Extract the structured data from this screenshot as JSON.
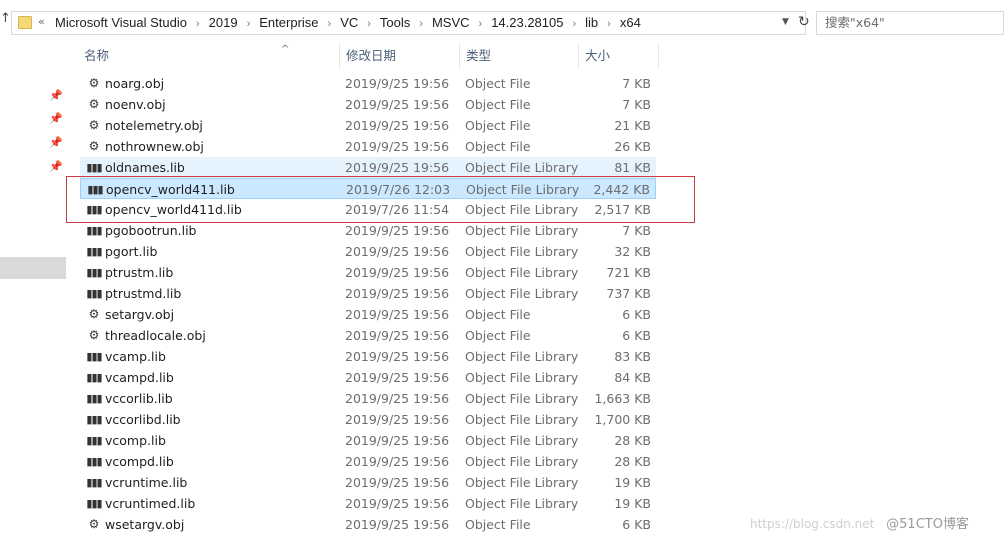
{
  "address_bar": {
    "breadcrumbs": [
      "Microsoft Visual Studio",
      "2019",
      "Enterprise",
      "VC",
      "Tools",
      "MSVC",
      "14.23.28105",
      "lib",
      "x64"
    ]
  },
  "search": {
    "placeholder": "搜索\"x64\""
  },
  "columns": {
    "name": "名称",
    "modified": "修改日期",
    "type": "类型",
    "size": "大小"
  },
  "files": [
    {
      "name": "noarg.obj",
      "modified": "2019/9/25 19:56",
      "type": "Object File",
      "size": "7 KB",
      "icon": "obj-file-icon"
    },
    {
      "name": "noenv.obj",
      "modified": "2019/9/25 19:56",
      "type": "Object File",
      "size": "7 KB",
      "icon": "obj-file-icon"
    },
    {
      "name": "notelemetry.obj",
      "modified": "2019/9/25 19:56",
      "type": "Object File",
      "size": "21 KB",
      "icon": "obj-file-icon"
    },
    {
      "name": "nothrownew.obj",
      "modified": "2019/9/25 19:56",
      "type": "Object File",
      "size": "26 KB",
      "icon": "obj-file-icon"
    },
    {
      "name": "oldnames.lib",
      "modified": "2019/9/25 19:56",
      "type": "Object File Library",
      "size": "81 KB",
      "icon": "lib-file-icon",
      "state": "hover"
    },
    {
      "name": "opencv_world411.lib",
      "modified": "2019/7/26 12:03",
      "type": "Object File Library",
      "size": "2,442 KB",
      "icon": "lib-file-icon",
      "state": "selected"
    },
    {
      "name": "opencv_world411d.lib",
      "modified": "2019/7/26 11:54",
      "type": "Object File Library",
      "size": "2,517 KB",
      "icon": "lib-file-icon"
    },
    {
      "name": "pgobootrun.lib",
      "modified": "2019/9/25 19:56",
      "type": "Object File Library",
      "size": "7 KB",
      "icon": "lib-file-icon"
    },
    {
      "name": "pgort.lib",
      "modified": "2019/9/25 19:56",
      "type": "Object File Library",
      "size": "32 KB",
      "icon": "lib-file-icon"
    },
    {
      "name": "ptrustm.lib",
      "modified": "2019/9/25 19:56",
      "type": "Object File Library",
      "size": "721 KB",
      "icon": "lib-file-icon"
    },
    {
      "name": "ptrustmd.lib",
      "modified": "2019/9/25 19:56",
      "type": "Object File Library",
      "size": "737 KB",
      "icon": "lib-file-icon"
    },
    {
      "name": "setargv.obj",
      "modified": "2019/9/25 19:56",
      "type": "Object File",
      "size": "6 KB",
      "icon": "obj-file-icon"
    },
    {
      "name": "threadlocale.obj",
      "modified": "2019/9/25 19:56",
      "type": "Object File",
      "size": "6 KB",
      "icon": "obj-file-icon"
    },
    {
      "name": "vcamp.lib",
      "modified": "2019/9/25 19:56",
      "type": "Object File Library",
      "size": "83 KB",
      "icon": "lib-file-icon"
    },
    {
      "name": "vcampd.lib",
      "modified": "2019/9/25 19:56",
      "type": "Object File Library",
      "size": "84 KB",
      "icon": "lib-file-icon"
    },
    {
      "name": "vccorlib.lib",
      "modified": "2019/9/25 19:56",
      "type": "Object File Library",
      "size": "1,663 KB",
      "icon": "lib-file-icon"
    },
    {
      "name": "vccorlibd.lib",
      "modified": "2019/9/25 19:56",
      "type": "Object File Library",
      "size": "1,700 KB",
      "icon": "lib-file-icon"
    },
    {
      "name": "vcomp.lib",
      "modified": "2019/9/25 19:56",
      "type": "Object File Library",
      "size": "28 KB",
      "icon": "lib-file-icon"
    },
    {
      "name": "vcompd.lib",
      "modified": "2019/9/25 19:56",
      "type": "Object File Library",
      "size": "28 KB",
      "icon": "lib-file-icon"
    },
    {
      "name": "vcruntime.lib",
      "modified": "2019/9/25 19:56",
      "type": "Object File Library",
      "size": "19 KB",
      "icon": "lib-file-icon"
    },
    {
      "name": "vcruntimed.lib",
      "modified": "2019/9/25 19:56",
      "type": "Object File Library",
      "size": "19 KB",
      "icon": "lib-file-icon"
    },
    {
      "name": "wsetargv.obj",
      "modified": "2019/9/25 19:56",
      "type": "Object File",
      "size": "6 KB",
      "icon": "obj-file-icon"
    }
  ],
  "watermark": {
    "text": "https://blog.csdn.net",
    "brand": "@51CTO博客"
  },
  "colors": {
    "selected_bg": "#cce8ff",
    "hover_bg": "#e5f3ff",
    "annotation_box": "#cd3b45",
    "header_text": "#4c607a"
  }
}
